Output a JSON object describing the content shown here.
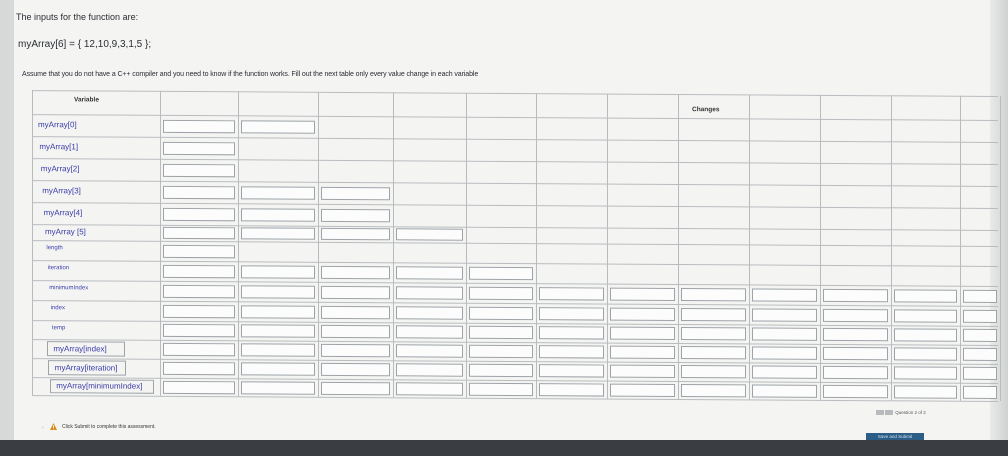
{
  "intro": "The inputs for the function are:",
  "array_def": "myArray[6] = { 12,10,9,3,1,5 };",
  "instructions": "Assume that you do not have a C++ compiler and you need to know if the function works. Fill out the next table only every value change in each variable",
  "table": {
    "col_variable": "Variable",
    "col_changes": "Changes",
    "rows": [
      {
        "label": "myArray[0]",
        "boxes": 2
      },
      {
        "label": "myArray[1]",
        "boxes": 1
      },
      {
        "label": "myArray[2]",
        "boxes": 1
      },
      {
        "label": "myArray[3]",
        "boxes": 3
      },
      {
        "label": "myArray[4]",
        "boxes": 3
      },
      {
        "label": "myArray [5]",
        "boxes": 4
      },
      {
        "label": "length",
        "boxes": 1
      },
      {
        "label": "iteration",
        "boxes": 5
      },
      {
        "label": "minimumIndex",
        "boxes": 12
      },
      {
        "label": "index",
        "boxes": 12
      },
      {
        "label": "temp",
        "boxes": 12
      },
      {
        "label": "myArray[index]",
        "boxes": 12
      },
      {
        "label": "myArray[iteration]",
        "boxes": 12
      },
      {
        "label": "myArray[minimumIndex]",
        "boxes": 12
      }
    ]
  },
  "footer": {
    "note": "Click Submit to complete this assessment.",
    "question": "Question 2 of 2",
    "save_button": "Save and Submit"
  }
}
